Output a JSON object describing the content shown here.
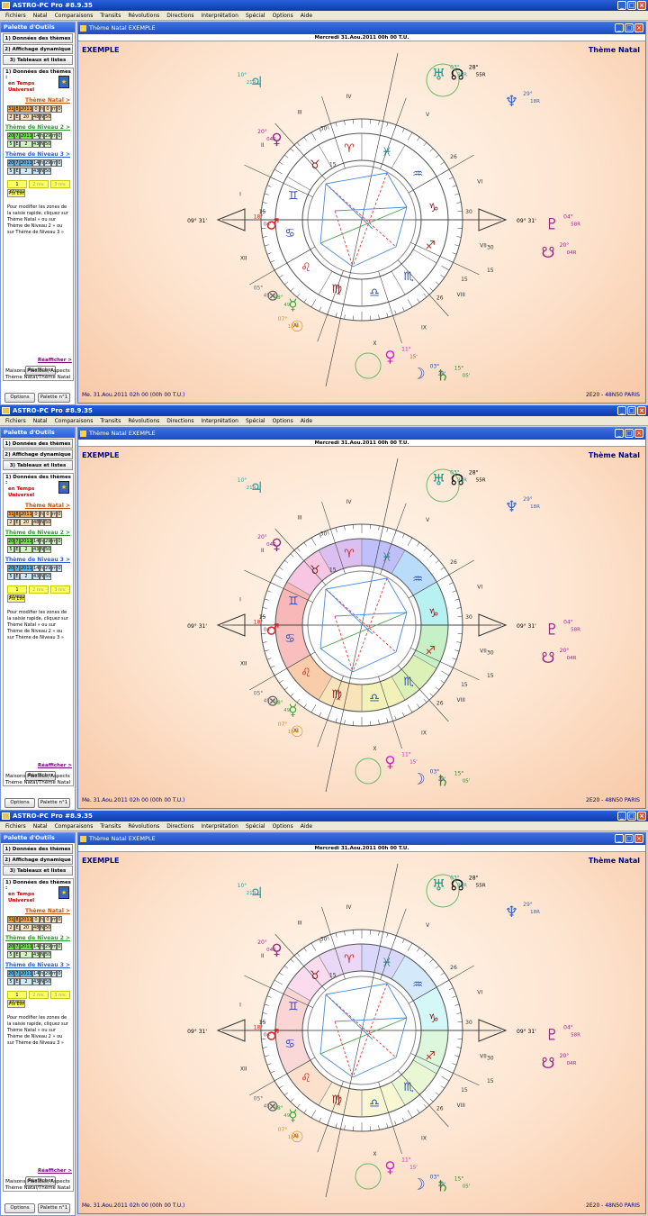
{
  "app": {
    "title": "ASTRO-PC Pro #8.9.35"
  },
  "menu": [
    "Fichiers",
    "Natal",
    "Comparaisons",
    "Transits",
    "Révolutions",
    "Directions",
    "Interprétation",
    "Spécial",
    "Options",
    "Aide"
  ],
  "palette": {
    "title": "Palette d'Outils",
    "sections": [
      "1) Données des thèmes",
      "2) Affichage dynamique",
      "3) Tableaux et listes"
    ],
    "box_title": "1) Données des thèmes :",
    "time_mode": [
      "en Temps",
      "Universel"
    ],
    "natal_link": "Thème Natal >",
    "natal_row1": [
      "31",
      "8",
      "2011",
      "0",
      "h",
      "0",
      "m",
      "0"
    ],
    "natal_row2": [
      "2",
      "E",
      "20",
      "48",
      "N",
      "50"
    ],
    "level2_link": "Thème de Niveau 2 >",
    "level2_row1": [
      "20",
      "7",
      "2011",
      "14",
      "h",
      "29",
      "m",
      "0"
    ],
    "level2_row2": [
      "5",
      "E",
      "2",
      "43",
      "N",
      "50"
    ],
    "level3_link": "Thème de Niveau 3 >",
    "level3_row1": [
      "20",
      "7",
      "2011",
      "14",
      "h",
      "29",
      "m",
      "0"
    ],
    "level3_row2": [
      "5",
      "E",
      "2",
      "43",
      "N",
      "50"
    ],
    "levels": [
      "1 niveau",
      "2 niv.",
      "3 niv."
    ],
    "pts_ext": "Pts Ext",
    "help": "Pour modifier les zones de la saisie rapide, cliquez sur Thème Natal » ou sur Thème de Niveau 2 » ou sur Thème de Niveau 3 »",
    "refresh_button": "Réafficher",
    "refresh_link": "Réafficher >",
    "status": "Maisons Placidus, Aspects Thème Natal/Thème Natal",
    "options_button": "Options",
    "palette_button": "Palette n°1"
  },
  "chart_window": {
    "title": "Thème Natal  EXEMPLE",
    "date_header": "Mercredi 31.Aou.2011 00h 00 T.U.",
    "name": "EXEMPLE",
    "kind": "Thème Natal",
    "footer_left": "Me. 31.Aou.2011 02h 00 (00h 00 T.U.)",
    "footer_right": "2E20 - 48N50  PARIS"
  },
  "chart_data": {
    "type": "astrological wheel",
    "asc": "09° 31'",
    "mc_labels": [
      "09°",
      "31'"
    ],
    "houses": [
      "I",
      "II",
      "III",
      "IV",
      "V",
      "VI",
      "VII",
      "VIII",
      "IX",
      "X",
      "XI",
      "XII"
    ],
    "degree_marks": [
      "30",
      "15",
      "26",
      "30",
      "30",
      "15",
      "15",
      "26",
      "15"
    ],
    "signs": [
      "♈",
      "♓",
      "♒",
      "♑",
      "♐",
      "♏",
      "♎",
      "♍",
      "♌",
      "♋",
      "♊",
      "♉"
    ],
    "planets": [
      {
        "glyph": "♃",
        "deg": "10°",
        "min": "21R",
        "color": "#2aa0a0"
      },
      {
        "glyph": "☊",
        "deg": "28°",
        "min": "55R",
        "color": "#000000"
      },
      {
        "glyph": "♅",
        "deg": "03°",
        "min": "35R",
        "color": "#1a9a8a"
      },
      {
        "glyph": "♆",
        "deg": "29°",
        "min": "18R",
        "color": "#3a66c8"
      },
      {
        "glyph": "♀",
        "deg": "20°",
        "min": "04R",
        "color": "#9a2a8a"
      },
      {
        "glyph": "♇",
        "deg": "04°",
        "min": "58R",
        "color": "#9a2a8a"
      },
      {
        "glyph": "☋",
        "deg": "20°",
        "min": "04R",
        "color": "#9a2a8a"
      },
      {
        "glyph": "♂",
        "deg": "18°",
        "min": "04'",
        "color": "#e02020"
      },
      {
        "glyph": "⊗",
        "deg": "05°",
        "min": "45'",
        "color": "#666666"
      },
      {
        "glyph": "☿",
        "deg": "18°",
        "min": "49'",
        "color": "#3aa83a"
      },
      {
        "glyph": "☉",
        "deg": "07°",
        "min": "18'",
        "color": "#f08a00"
      },
      {
        "glyph": "♀",
        "deg": "11°",
        "min": "15'",
        "color": "#d020d0"
      },
      {
        "glyph": "☽",
        "deg": "03°",
        "min": "29'",
        "color": "#2a4ab0"
      },
      {
        "glyph": "♄",
        "deg": "15°",
        "min": "05'",
        "color": "#2a8a2a"
      }
    ]
  }
}
